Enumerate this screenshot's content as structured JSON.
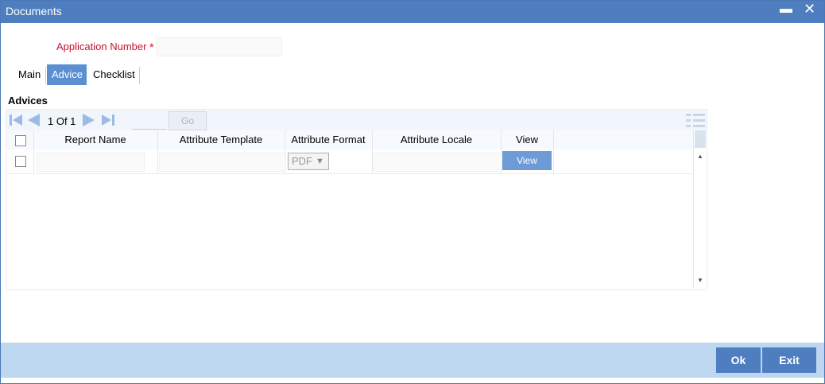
{
  "window": {
    "title": "Documents",
    "minimize_label": "▬",
    "close_label": "✕"
  },
  "form": {
    "application_number_label": "Application Number",
    "required_marker": "*",
    "application_number_value": ""
  },
  "tabs": [
    {
      "label": "Main",
      "active": false
    },
    {
      "label": "Advice",
      "active": true
    },
    {
      "label": "Checklist",
      "active": false
    }
  ],
  "advices": {
    "section_title": "Advices",
    "pagination": {
      "text": "1 Of 1",
      "go_label": "Go",
      "page_input": ""
    },
    "columns": [
      "Report Name",
      "Attribute Template",
      "Attribute Format",
      "Attribute Locale",
      "View"
    ],
    "rows": [
      {
        "report_name": "",
        "attribute_template": "",
        "attribute_format": "PDF",
        "attribute_locale": "",
        "view_label": "View"
      }
    ]
  },
  "footer": {
    "ok_label": "Ok",
    "exit_label": "Exit"
  },
  "colors": {
    "titlebar": "#4f7ec0",
    "active_tab": "#5b8fd1",
    "required_label": "#c8102e",
    "footer": "#bcd7ef"
  }
}
